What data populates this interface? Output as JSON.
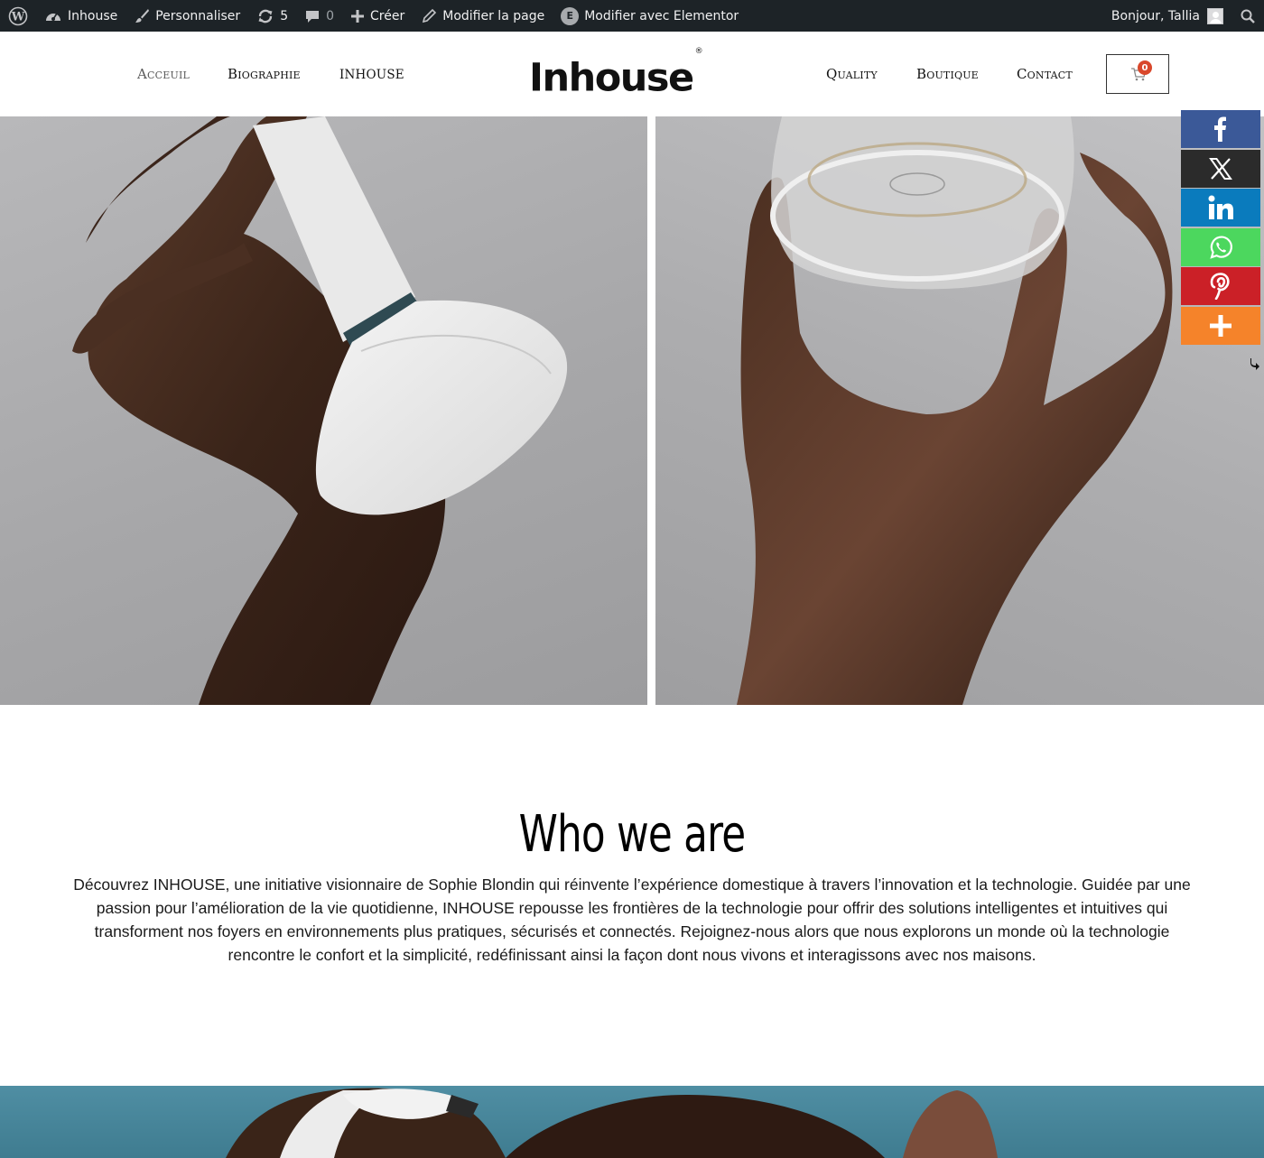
{
  "admin_bar": {
    "site_name": "Inhouse",
    "customize": "Personnaliser",
    "updates_count": "5",
    "comments_count": "0",
    "new": "Créer",
    "edit_page": "Modifier la page",
    "elementor": "Modifier avec Elementor",
    "elementor_badge": "E",
    "greeting": "Bonjour, Tallia"
  },
  "header": {
    "logo": "Inhouse",
    "logo_mark": "®",
    "nav_left": [
      "Acceuil",
      "Biographie",
      "INHOUSE"
    ],
    "nav_right": [
      "Quality",
      "Boutique",
      "Contact"
    ],
    "cart_count": "0"
  },
  "share_bar": {
    "buttons": [
      {
        "name": "facebook",
        "color": "#3b5998"
      },
      {
        "name": "x",
        "color": "#2b2b2b"
      },
      {
        "name": "linkedin",
        "color": "#0a7bbd"
      },
      {
        "name": "whatsapp",
        "color": "#4cd75e"
      },
      {
        "name": "pinterest",
        "color": "#cb2027"
      },
      {
        "name": "more",
        "color": "#f5832a"
      }
    ]
  },
  "who": {
    "title": "Who we are",
    "text": "Découvrez INHOUSE, une initiative visionnaire de Sophie Blondin qui réinvente l’expérience domestique à travers l’innovation et la technologie. Guidée par une passion pour l’amélioration de la vie quotidienne, INHOUSE repousse les frontières de la technologie pour offrir des solutions intelligentes et intuitives qui transforment nos foyers en environnements plus pratiques, sécurisés et connectés. Rejoignez-nous alors que nous explorons un monde où la technologie rencontre le confort et la simplicité, redéfinissant ainsi la façon dont nous vivons et interagissons avec nos maisons."
  }
}
